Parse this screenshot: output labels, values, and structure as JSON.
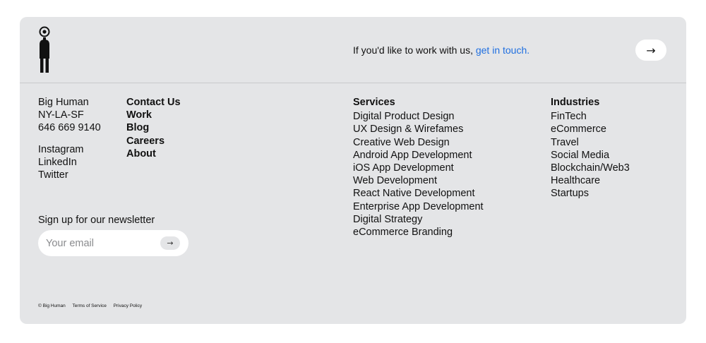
{
  "header": {
    "cta_prefix": "If you'd like to work with us, ",
    "cta_link": "get in touch.",
    "cta_button_icon": "→"
  },
  "company": {
    "name": "Big Human",
    "locations": "NY-LA-SF",
    "phone": "646 669 9140",
    "social": [
      "Instagram",
      "LinkedIn",
      "Twitter"
    ]
  },
  "nav": [
    "Contact Us",
    "Work",
    "Blog",
    "Careers",
    "About"
  ],
  "services": {
    "heading": "Services",
    "items": [
      "Digital Product Design",
      "UX Design & Wirefames",
      "Creative Web Design",
      "Android App Development",
      "iOS App Development",
      "Web Development",
      "React Native Development",
      "Enterprise App Development",
      "Digital Strategy",
      "eCommerce Branding"
    ]
  },
  "industries": {
    "heading": "Industries",
    "items": [
      "FinTech",
      "eCommerce",
      "Travel",
      "Social Media",
      "Blockchain/Web3",
      "Healthcare",
      "Startups"
    ]
  },
  "newsletter": {
    "label": "Sign up for our newsletter",
    "placeholder": "Your email",
    "button_icon": "→"
  },
  "legal": [
    "© Big Human",
    "Terms of Service",
    "Privacy Policy"
  ],
  "colors": {
    "panel": "#e4e5e7",
    "link": "#1f6fe0"
  }
}
